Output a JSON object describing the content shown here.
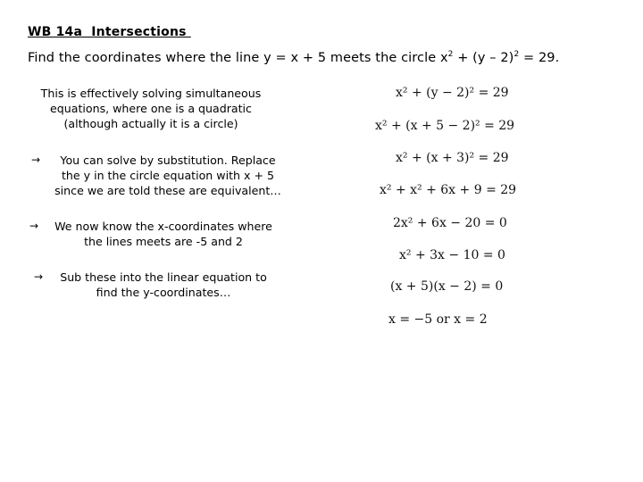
{
  "title": "WB 14a  Intersections ",
  "question": {
    "prefix": "Find the coordinates where the line y = x + 5 meets the circle  x",
    "sq1": "2",
    "mid": " + (y – 2)",
    "sq2": "2",
    "suffix": " = 29."
  },
  "intro_lines": [
    "This is effectively solving simultaneous",
    "equations, where one is a quadratic",
    "(although actually it is a circle)"
  ],
  "bullets": [
    {
      "icon": "→",
      "lines": [
        "You can solve by substitution. Replace",
        "the y in the circle equation with x + 5",
        "since we are told these are equivalent…"
      ]
    },
    {
      "icon": "→",
      "lines": [
        "We now know the x-coordinates where",
        "the lines meets are -5 and 2"
      ]
    },
    {
      "icon": "→",
      "lines": [
        "Sub these into the linear equation to",
        "find the y-coordinates…"
      ]
    }
  ],
  "working": [
    "x² + (y − 2)² = 29",
    "x² + (x + 5 − 2)² = 29",
    "x² + (x + 3)² = 29",
    "x² + x² + 6x + 9 = 29",
    "2x² + 6x − 20 = 0",
    "x² + 3x − 10 = 0",
    "(x + 5)(x − 2) = 0",
    "x = −5  or  x = 2"
  ]
}
